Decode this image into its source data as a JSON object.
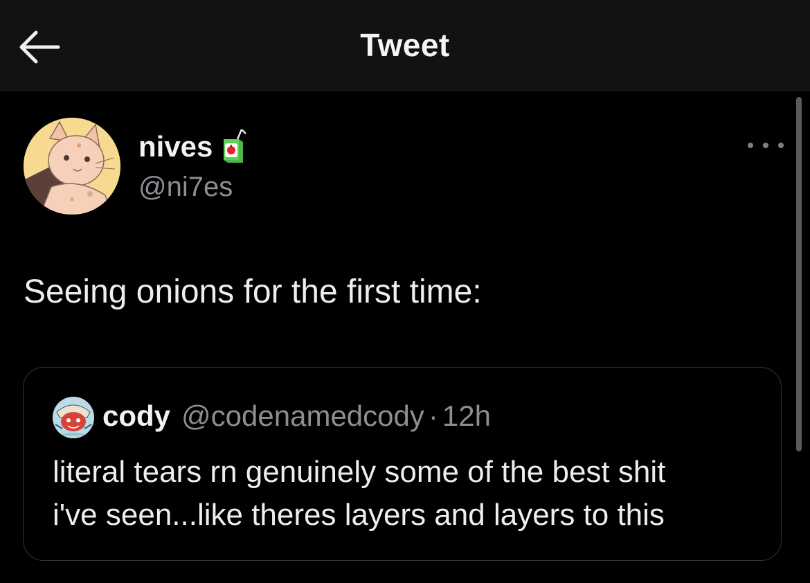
{
  "header": {
    "title": "Tweet",
    "back_icon": "arrow-left-icon"
  },
  "tweet": {
    "author": {
      "display_name": "nives",
      "name_emoji": "juice-box-emoji",
      "handle": "@ni7es"
    },
    "more_icon": "ellipsis-icon",
    "text": "Seeing onions for the first time:"
  },
  "quoted_tweet": {
    "author": {
      "display_name": "cody",
      "handle": "@codenamedcody"
    },
    "separator": "·",
    "time": "12h",
    "text_lines": [
      "literal tears rn genuinely some of the best shit",
      "i've seen...like theres layers and layers to this"
    ]
  },
  "colors": {
    "background": "#000000",
    "header_background": "#121212",
    "primary_text": "#e7e9ea",
    "secondary_text": "#8b8f94",
    "card_border": "#2f3336"
  }
}
